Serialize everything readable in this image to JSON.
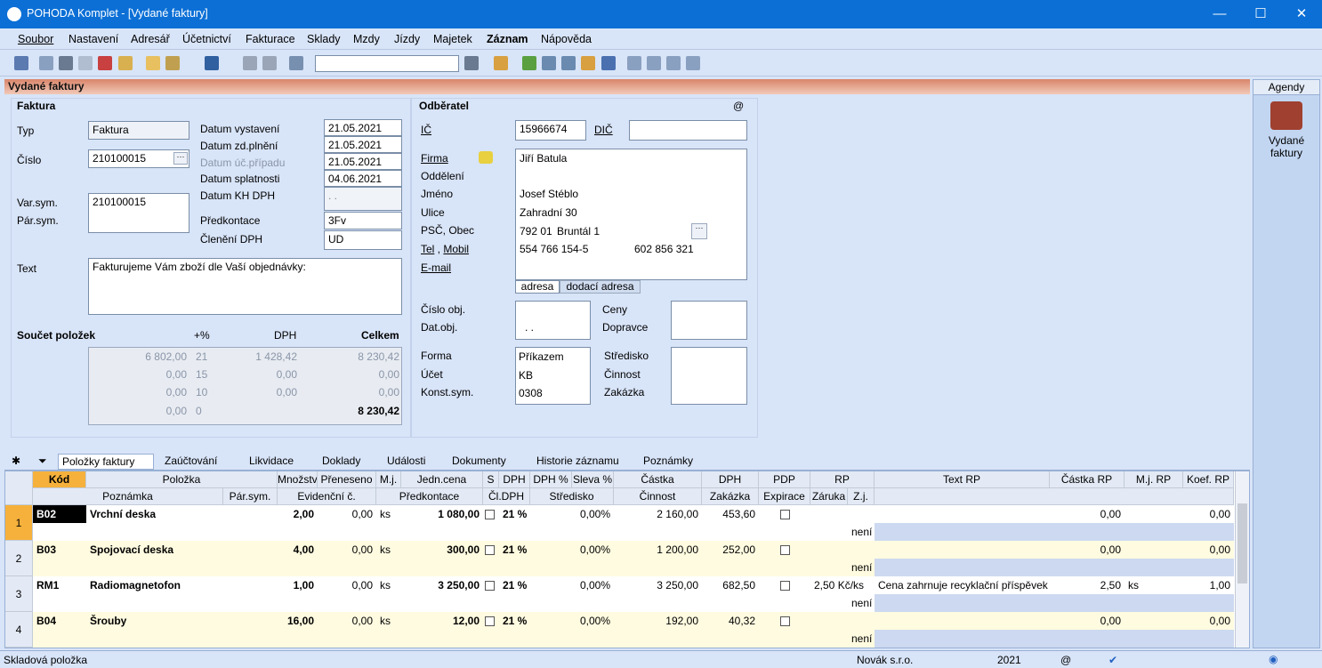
{
  "window": {
    "title": "POHODA Komplet - [Vydané faktury]",
    "min": "—",
    "max": "☐",
    "close": "✕"
  },
  "menu": [
    "Soubor",
    "Nastavení",
    "Adresář",
    "Účetnictví",
    "Fakturace",
    "Sklady",
    "Mzdy",
    "Jízdy",
    "Majetek",
    "Záznam",
    "Nápověda"
  ],
  "agenda_title": "Vydané faktury",
  "agendy": {
    "header": "Agendy",
    "item": "Vydané faktury"
  },
  "faktura": {
    "section": "Faktura",
    "typ_label": "Typ",
    "typ_value": "Faktura",
    "cislo_label": "Číslo",
    "cislo_value": "210100015",
    "varsym_label": "Var.sym.",
    "varsym_value": "210100015",
    "parsym_label": "Pár.sym.",
    "dates": [
      {
        "label": "Datum vystavení",
        "value": "21.05.2021"
      },
      {
        "label": "Datum zd.plnění",
        "value": "21.05.2021"
      },
      {
        "label": "Datum úč.případu",
        "value": "21.05.2021"
      },
      {
        "label": "Datum splatnosti",
        "value": "04.06.2021"
      },
      {
        "label": "Datum KH DPH",
        "value": ". ."
      }
    ],
    "predkontace_label": "Předkontace",
    "predkontace_value": "3Fv",
    "cleneni_label": "Členění DPH",
    "cleneni_value": "UD",
    "text_label": "Text",
    "text_value": "Fakturujeme Vám zboží dle Vaší objednávky:"
  },
  "soucet": {
    "label": "Součet položek",
    "h_pct": "+%",
    "h_dph": "DPH",
    "h_celkem": "Celkem",
    "rows": [
      {
        "base": "6 802,00",
        "pct": "21",
        "dph": "1 428,42",
        "celkem": "8 230,42"
      },
      {
        "base": "0,00",
        "pct": "15",
        "dph": "0,00",
        "celkem": "0,00"
      },
      {
        "base": "0,00",
        "pct": "10",
        "dph": "0,00",
        "celkem": "0,00"
      },
      {
        "base": "0,00",
        "pct": "0",
        "dph": "",
        "celkem": "8 230,42"
      }
    ]
  },
  "odberatel": {
    "section": "Odběratel",
    "at": "@",
    "ic_label": "IČ",
    "ic_value": "15966674",
    "dic_label": "DIČ",
    "firma_label": "Firma",
    "firma_value": "Jiří Batula",
    "oddeleni_label": "Oddělení",
    "jmeno_label": "Jméno",
    "jmeno_value": "Josef Stéblo",
    "ulice_label": "Ulice",
    "ulice_value": "Zahradní 30",
    "psc_label": "PSČ, Obec",
    "psc_value": "792 01",
    "obec_value": "Bruntál 1",
    "tel_label": "Tel",
    "mobil_label": "Mobil",
    "tel_value": "554 766 154-5",
    "mobil_value": "602 856 321",
    "email_label": "E-mail",
    "tab_adresa": "adresa",
    "tab_dodaci": "dodací adresa",
    "cisloobj_label": "Číslo obj.",
    "datobj_label": "Dat.obj.",
    "datobj_value": ". .",
    "ceny_label": "Ceny",
    "dopravce_label": "Dopravce",
    "forma_label": "Forma",
    "forma_value": "Příkazem",
    "ucet_label": "Účet",
    "ucet_value": "KB",
    "konst_label": "Konst.sym.",
    "konst_value": "0308",
    "stredisko_label": "Středisko",
    "cinnost_label": "Činnost",
    "zakazka_label": "Zakázka"
  },
  "tabs": [
    "Položky faktury",
    "Zaúčtování",
    "Likvidace",
    "Doklady",
    "Události",
    "Dokumenty",
    "Historie záznamu",
    "Poznámky"
  ],
  "grid": {
    "h1": [
      "Kód",
      "Položka",
      "Množství",
      "Přeneseno",
      "M.j.",
      "Jedn.cena",
      "S",
      "DPH",
      "DPH %",
      "Sleva %",
      "Částka",
      "DPH",
      "PDP",
      "RP",
      "Text RP",
      "Částka RP",
      "M.j. RP",
      "Koef. RP"
    ],
    "h2": [
      "Poznámka",
      "Pár.sym.",
      "Evidenční č.",
      "Předkontace",
      "Čl.DPH",
      "Středisko",
      "Činnost",
      "Zakázka",
      "Expirace",
      "Záruka",
      "Z.j."
    ],
    "rows": [
      {
        "n": "1",
        "kod": "B02",
        "pol": "Vrchní deska",
        "mn": "2,00",
        "pr": "0,00",
        "mj": "ks",
        "cena": "1 080,00",
        "dph": "21 %",
        "dphp": "0,00%",
        "castka": "2 160,00",
        "dphv": "453,60",
        "rp": "",
        "textrp": "",
        "castkarp": "0,00",
        "mjrp": "",
        "koef": "0,00",
        "zj": "není"
      },
      {
        "n": "2",
        "kod": "B03",
        "pol": "Spojovací deska",
        "mn": "4,00",
        "pr": "0,00",
        "mj": "ks",
        "cena": "300,00",
        "dph": "21 %",
        "dphp": "0,00%",
        "castka": "1 200,00",
        "dphv": "252,00",
        "rp": "",
        "textrp": "",
        "castkarp": "0,00",
        "mjrp": "",
        "koef": "0,00",
        "zj": "není"
      },
      {
        "n": "3",
        "kod": "RM1",
        "pol": "Radiomagnetofon",
        "mn": "1,00",
        "pr": "0,00",
        "mj": "ks",
        "cena": "3 250,00",
        "dph": "21 %",
        "dphp": "0,00%",
        "castka": "3 250,00",
        "dphv": "682,50",
        "rp": "2,50 Kč/ks",
        "textrp": "Cena zahrnuje recyklační příspěvek",
        "castkarp": "2,50",
        "mjrp": "ks",
        "koef": "1,00",
        "zj": "není"
      },
      {
        "n": "4",
        "kod": "B04",
        "pol": "Šrouby",
        "mn": "16,00",
        "pr": "0,00",
        "mj": "ks",
        "cena": "12,00",
        "dph": "21 %",
        "dphp": "0,00%",
        "castka": "192,00",
        "dphv": "40,32",
        "rp": "",
        "textrp": "",
        "castkarp": "0,00",
        "mjrp": "",
        "koef": "0,00",
        "zj": "není"
      }
    ]
  },
  "status": {
    "left": "Skladová položka",
    "company": "Novák s.r.o.",
    "year": "2021",
    "at": "@"
  }
}
